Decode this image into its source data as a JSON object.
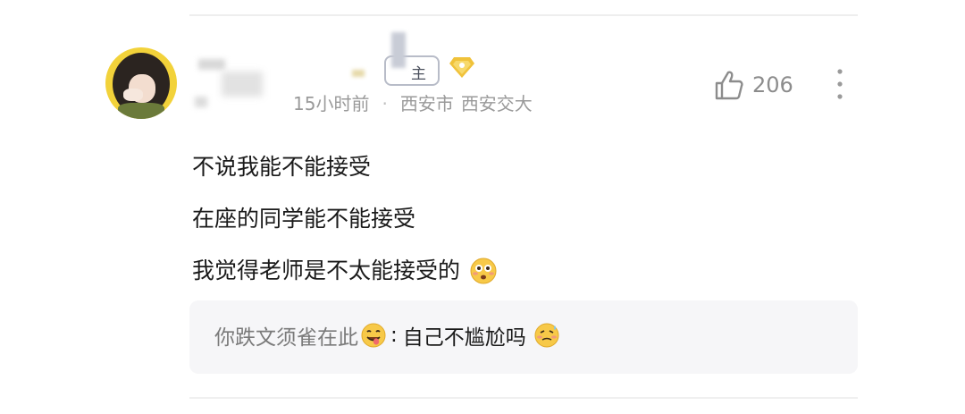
{
  "comment": {
    "owner_badge": "主",
    "timestamp": "15小时前",
    "separator": "·",
    "location_city": "西安市",
    "location_school": "西安交大",
    "like_count": "206",
    "lines": [
      "不说我能不能接受",
      "在座的同学能不能接受",
      "我觉得老师是不太能接受的"
    ],
    "icons": {
      "like": "thumbs-up-icon",
      "more": "more-vertical-icon",
      "badge": "diamond-icon",
      "line_emoji": "flushed-face-emoji",
      "reply_user_emoji": "tongue-face-emoji",
      "reply_end_emoji": "embarrassed-face-emoji"
    }
  },
  "reply": {
    "user": "你跌文须雀在此",
    "colon": ":",
    "text": "自己不尴尬吗"
  },
  "colors": {
    "meta_text": "#9a9a9a",
    "reply_bg": "#f6f6f8",
    "avatar_ring": "#f2d23a",
    "badge_gold": "#f0c23a"
  }
}
